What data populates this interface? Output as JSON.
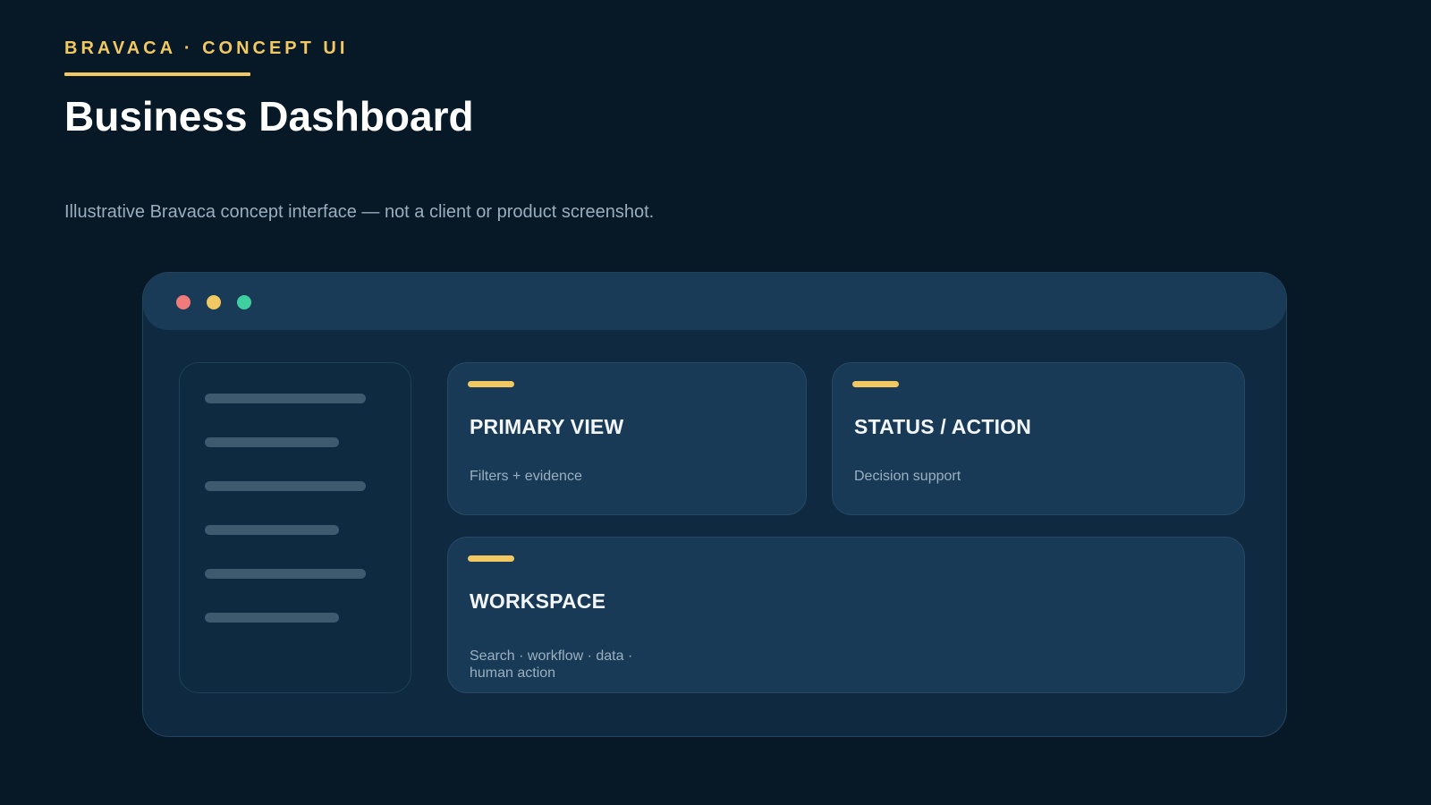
{
  "header": {
    "kicker": "BRAVACA · CONCEPT UI",
    "title": "Business Dashboard",
    "subtitle": "Illustrative Bravaca concept interface — not a client or product screenshot."
  },
  "window": {
    "controls": [
      {
        "name": "close",
        "color": "#ef7b7b"
      },
      {
        "name": "minimize",
        "color": "#f2c862"
      },
      {
        "name": "maximize",
        "color": "#3fcfa0"
      }
    ]
  },
  "cards": {
    "primary": {
      "title": "PRIMARY VIEW",
      "subtitle": "Filters + evidence"
    },
    "status": {
      "title": "STATUS / ACTION",
      "subtitle": "Decision support"
    },
    "workspace": {
      "title": "WORKSPACE",
      "subtitle": "Search · workflow · data · human action"
    }
  },
  "colors": {
    "background": "#071827",
    "accent": "#f2c862",
    "panel": "#183a56"
  }
}
